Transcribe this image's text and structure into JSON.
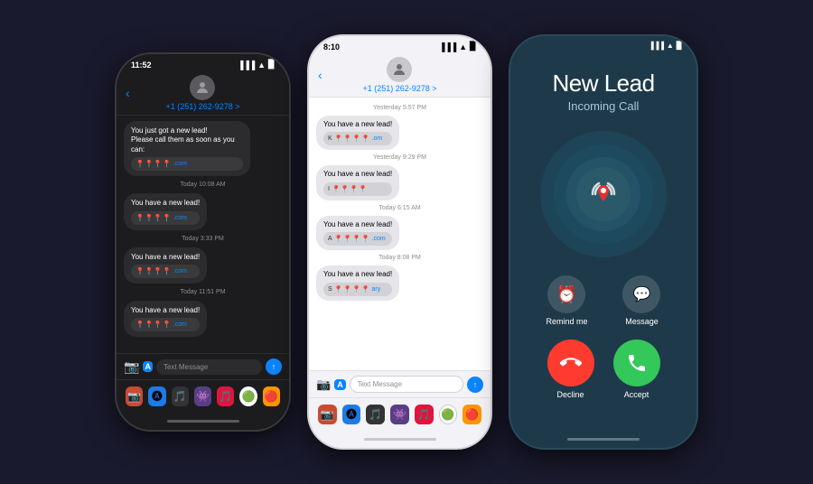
{
  "phone1": {
    "status_time": "11:52",
    "contact_number": "+1 (251) 262-9278 >",
    "messages": [
      {
        "text": "You just got a new lead!",
        "sub": "Please call them as soon as you can:",
        "has_card": true,
        "card_pins": "📍📍📍📍",
        "card_link": ".com"
      },
      {
        "timestamp": "Today 10:08 AM",
        "text": "You have a new lead!",
        "has_card": true,
        "card_pins": "📍📍📍📍",
        "card_link": ".com"
      },
      {
        "timestamp": "Today 3:33 PM",
        "text": "You have a new lead!",
        "has_card": true,
        "card_pins": "📍📍📍📍",
        "card_link": ".com"
      },
      {
        "timestamp": "Today 11:51 PM",
        "text": "You have a new lead!",
        "has_card": true,
        "card_pins": "📍📍📍📍",
        "card_link": ".com"
      }
    ],
    "input_placeholder": "Text Message",
    "dock_icons": [
      "📷",
      "🅐",
      "🎵",
      "👾",
      "🎮",
      "🔴",
      "🟢"
    ]
  },
  "phone2": {
    "status_time": "8:10",
    "contact_number": "+1 (251) 262-9278 >",
    "messages": [
      {
        "timestamp": "Yesterday 5:57 PM",
        "text": "You have a new lead!",
        "has_card": true,
        "card_prefix": "K",
        "card_pins": "📍📍📍📍",
        "card_link": ".om"
      },
      {
        "timestamp": "Yesterday 9:29 PM",
        "text": "You have a new lead!",
        "has_card": true,
        "card_prefix": "I",
        "card_pins": "📍📍📍📍",
        "card_link": ""
      },
      {
        "timestamp": "Today 6:15 AM",
        "text": "You have a new lead!",
        "has_card": true,
        "card_prefix": "A",
        "card_pins": "📍📍📍📍",
        "card_link": ".com"
      },
      {
        "timestamp": "Today 8:08 PM",
        "text": "You have a new lead!",
        "has_card": true,
        "card_prefix": "S",
        "card_pins": "📍📍📍📍",
        "card_link": "ary"
      }
    ],
    "input_placeholder": "Text Message",
    "dock_icons": [
      "📷",
      "🅐",
      "🎵",
      "👾",
      "🎮",
      "🔴",
      "🟢"
    ]
  },
  "phone3": {
    "caller_name": "New Lead",
    "caller_subtitle": "Incoming Call",
    "action_remind": "Remind me",
    "action_message": "Message",
    "btn_decline": "Decline",
    "btn_accept": "Accept"
  }
}
